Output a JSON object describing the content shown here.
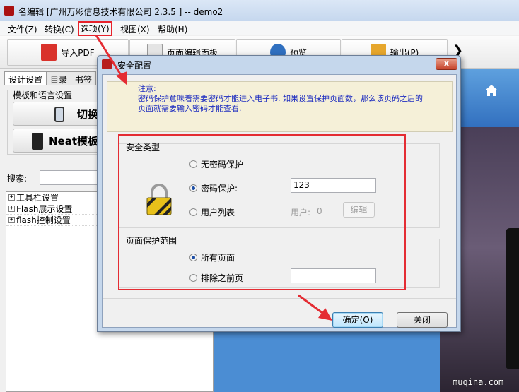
{
  "window": {
    "title": "名编辑 [广州万彩信息技术有限公司 2.3.5 ] -- demo2"
  },
  "menu": [
    "文件(Z)",
    "转换(C)",
    "选项(Y)",
    "视图(X)",
    "帮助(H)"
  ],
  "toolbar": {
    "import_pdf": "导入PDF",
    "page_editor": "页面编辑面板",
    "preview": "预览",
    "output": "输出(P)",
    "more": "❯"
  },
  "left_panel": {
    "tabs": [
      "设计设置",
      "目录",
      "书签"
    ],
    "template_group": "模板和语言设置",
    "switch_btn": "切换",
    "neat_btn": "Neat模板",
    "search_label": "搜索:",
    "tree": [
      "工具栏设置",
      "Flash展示设置",
      "flash控制设置"
    ]
  },
  "dialog": {
    "title": "安全配置",
    "close": "X",
    "note_line1": "注意:",
    "note_line2": "密码保护意味着需要密码才能进入电子书. 如果设置保护页面数，那么该页码之后的页面就需要输入密码才能查看.",
    "security_type": "安全类型",
    "no_password": "无密码保护",
    "password_protect": "密码保护:",
    "password_value": "123",
    "user_list": "用户列表",
    "user_label": "用户:",
    "user_count": "0",
    "edit_btn": "编辑",
    "page_range": "页面保护范围",
    "all_pages": "所有页面",
    "except_before": "排除之前页",
    "except_value": "",
    "ok_btn": "确定(O)",
    "close_btn": "关闭"
  },
  "watermark": "muqina.com",
  "colors": {
    "highlight": "#e42c33",
    "note_text": "#1f2ec0",
    "preview_blue": "#3c7ac2"
  }
}
